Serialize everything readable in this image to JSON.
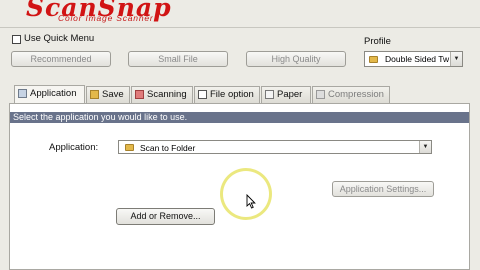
{
  "header": {
    "logo": "ScanSnap",
    "subtitle": "Color Image Scanner",
    "brand_color": "#d11414"
  },
  "quick_menu": {
    "label": "Use Quick Menu",
    "checked": false
  },
  "profile": {
    "label": "Profile",
    "selected": "Double Sided Tw",
    "icon": "folder-icon"
  },
  "presets": [
    "Recommended",
    "Small File",
    "High Quality"
  ],
  "tabs": [
    {
      "label": "Application",
      "icon": "application-icon",
      "active": true,
      "enabled": true
    },
    {
      "label": "Save",
      "icon": "save-icon",
      "active": false,
      "enabled": true
    },
    {
      "label": "Scanning",
      "icon": "scanning-icon",
      "active": false,
      "enabled": true
    },
    {
      "label": "File option",
      "icon": "file-option-icon",
      "active": false,
      "enabled": true
    },
    {
      "label": "Paper",
      "icon": "paper-icon",
      "active": false,
      "enabled": true
    },
    {
      "label": "Compression",
      "icon": "compression-icon",
      "active": false,
      "enabled": false
    }
  ],
  "application_panel": {
    "instruction": "Select the application you would like to use.",
    "application_label": "Application:",
    "selected_application": "Scan to Folder",
    "settings_button": "Application Settings...",
    "add_remove_button": "Add or Remove..."
  }
}
